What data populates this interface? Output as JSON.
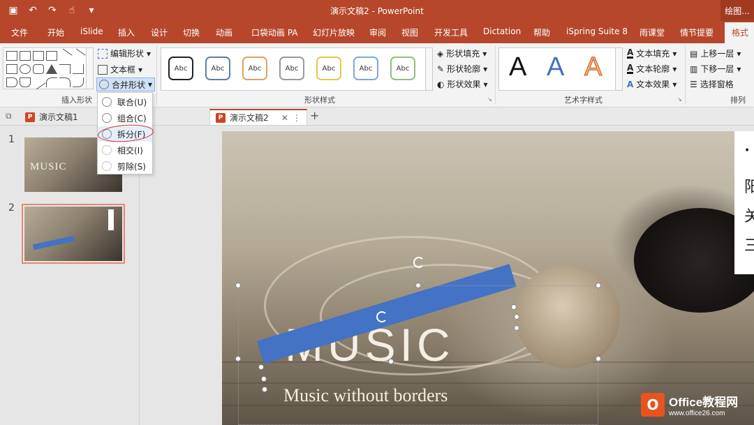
{
  "window": {
    "title": "演示文稿2  -  PowerPoint",
    "context_title": "绘图..."
  },
  "qat": {
    "save_icon": "save-icon",
    "undo_icon": "undo-icon",
    "redo_icon": "redo-icon",
    "touch_icon": "touch-mode-icon",
    "customize_icon": "customize-qat-icon"
  },
  "tabs": [
    "文件",
    "开始",
    "iSlide",
    "插入",
    "设计",
    "切换",
    "动画",
    "口袋动画 PA",
    "幻灯片放映",
    "审阅",
    "视图",
    "开发工具",
    "Dictation",
    "帮助",
    "iSpring Suite 8",
    "雨课堂",
    "情节提要",
    "格式"
  ],
  "ribbon": {
    "insert_shapes": {
      "label": "插入形状",
      "edit_shape": "编辑形状",
      "text_box": "文本框",
      "merge_shapes": "合并形状"
    },
    "shape_styles": {
      "label": "形状样式",
      "sample": "Abc",
      "fill": "形状填充",
      "outline": "形状轮廓",
      "effects": "形状效果"
    },
    "wordart": {
      "label": "艺术字样式",
      "letter": "A",
      "text_fill": "文本填充",
      "text_outline": "文本轮廓",
      "text_effects": "文本效果"
    },
    "arrange": {
      "label": "排列",
      "bring_forward": "上移一层",
      "send_backward": "下移一层",
      "selection_pane": "选择窗格"
    }
  },
  "merge_menu": [
    {
      "label": "联合(U)"
    },
    {
      "label": "组合(C)"
    },
    {
      "label": "拆分(F)"
    },
    {
      "label": "相交(I)"
    },
    {
      "label": "剪除(S)"
    }
  ],
  "doc_tabs": [
    {
      "label": "演示文稿1"
    },
    {
      "label": "演示文稿2"
    }
  ],
  "doc_tab_new": "+",
  "doc_tab_close": "✕",
  "doc_tab_more": "⋮",
  "thumbnails": [
    {
      "number": "1",
      "title": "MUSIC"
    },
    {
      "number": "2"
    }
  ],
  "slide": {
    "title": "MUSIC",
    "subtitle": "Music without borders",
    "side_text": [
      "•",
      "阳",
      "关",
      "三"
    ]
  },
  "watermark": {
    "logo": "O",
    "name": "Office教程网",
    "url": "www.office26.com"
  },
  "colors": {
    "accent": "#b7472a",
    "shape_fill": "#4472c4",
    "annotation": "#d62828"
  }
}
